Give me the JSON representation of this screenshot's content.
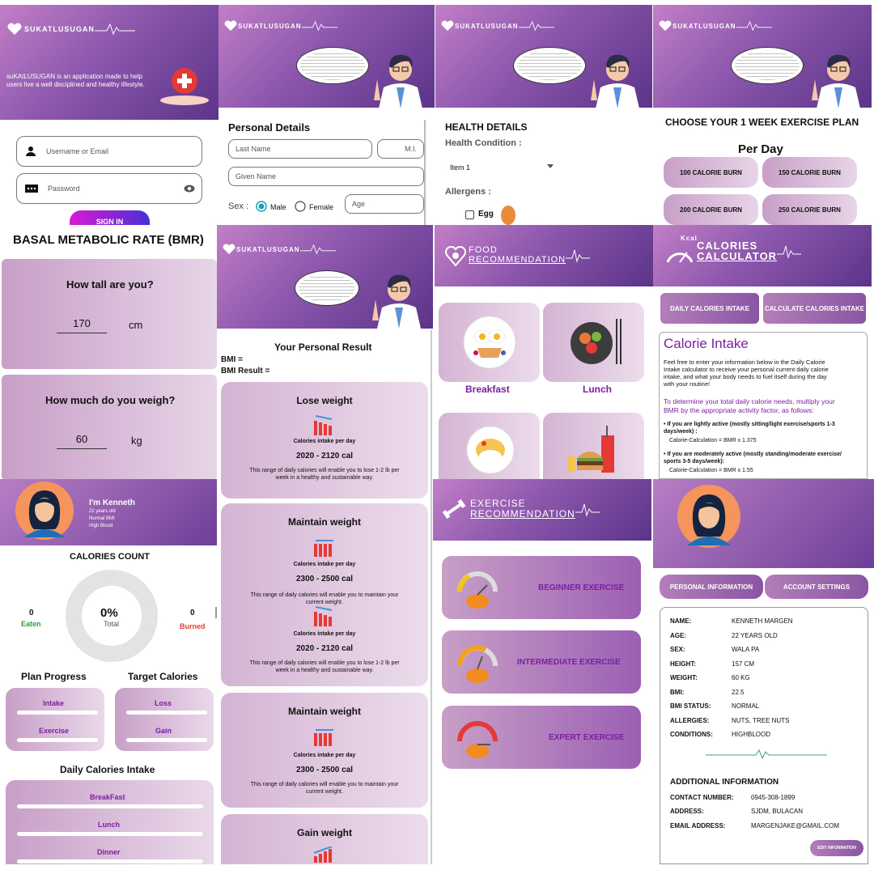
{
  "login": {
    "logo": "SUKATLUSUGAN",
    "tagline": "suKAtLUSUGAN is an application made to help users live a well disciplined and healthy lifestyle.",
    "username_placeholder": "Username or Email",
    "password_placeholder": "Password",
    "signin": "SIGN IN"
  },
  "personal": {
    "logo": "SUKATLUSUGAN",
    "title": "Personal Details",
    "last_name": "Last Name",
    "mi": "M.I.",
    "given_name": "Given Name",
    "sex_label": "Sex :",
    "male": "Male",
    "female": "Female",
    "age": "Age"
  },
  "health": {
    "logo": "SUKATLUSUGAN",
    "title": "HEALTH DETAILS",
    "condition_label": "Health Condition :",
    "condition_value": "Item 1",
    "allergens_label": "Allergens :",
    "egg": "Egg"
  },
  "exercise_plan": {
    "logo": "SUKATLUSUGAN",
    "title": "CHOOSE YOUR 1 WEEK EXERCISE PLAN",
    "subtitle": "Per Day",
    "options": [
      "100 CALORIE BURN",
      "150 CALORIE BURN",
      "200 CALORIE BURN",
      "250 CALORIE BURN"
    ]
  },
  "bmr": {
    "title": "BASAL METABOLIC RATE (BMR)",
    "q_height": "How tall are you?",
    "height": "170",
    "height_unit": "cm",
    "q_weight": "How much do you weigh?",
    "weight": "60",
    "weight_unit": "kg"
  },
  "result": {
    "logo": "SUKATLUSUGAN",
    "title": "Your Personal Result",
    "bmi": "BMI =",
    "bmi_result": "BMI Result =",
    "per_day": "Calories intake per day",
    "cards": [
      {
        "title": "Lose weight",
        "range": "2020 - 2120 cal",
        "desc1": "This range of daily calories will enable you to lose 1-2 lb per",
        "desc2": "week in a healthy and sustainable way."
      },
      {
        "title": "Maintain weight",
        "range": "2300 - 2500 cal",
        "desc1": "This range of daily calories will enable you to maintain your",
        "desc2": "current weight."
      },
      {
        "range": "2020 - 2120 cal",
        "desc1": "This range of daily calories will enable you to lose 1-2 lb per",
        "desc2": "week in a healthy and sustainable way."
      },
      {
        "title": "Maintain weight",
        "range": "2300 - 2500 cal",
        "desc1": "This range of daily calories will enable you to maintain your",
        "desc2": "current weight."
      },
      {
        "title": "Gain weight"
      }
    ]
  },
  "food": {
    "logo1": "FOOD",
    "logo2": "RECOMMENDATION",
    "breakfast": "Breakfast",
    "lunch": "Lunch"
  },
  "calc": {
    "logo1": "CALORIES",
    "logo2": "CALCULATOR",
    "kcal": "Kcal",
    "tab1": "DAILY CALORIES INTAKE",
    "tab2": "CALCULATE CALORIES INTAKE",
    "heading": "Calorie Intake",
    "p1": [
      "Feel free to enter your information below in the Daily Calorie",
      "Intake calculator to receive your personal current daily calorie",
      "intake, and what your body needs to fuel itself during the day",
      "with your routine!"
    ],
    "p2": [
      "To determine your total daily calorie needs, multiply your",
      "BMR by the appropriate activity factor, as follows:"
    ],
    "b1": [
      "• If you are lightly active (mostly sitting/light exercise/sports 1-3",
      "days/week) :"
    ],
    "c1": "Calorie-Calculation = BMR x 1.375",
    "b2": [
      "• If you are moderately active (mostly standing/moderate exercise/",
      "sports 3-5 days/week):"
    ],
    "c2": "Calorie-Calculation = BMR x 1.55"
  },
  "dash": {
    "name": "I'm Kenneth",
    "age": "22 years old",
    "bmi": "Normal BMI",
    "cond": "High Blood",
    "count_title": "CALORIES COUNT",
    "eaten_val": "0",
    "eaten": "Eaten",
    "total_val": "0%",
    "total": "Total",
    "burned_val": "0",
    "burned": "Burned",
    "plan": "Plan Progress",
    "target": "Target Calories",
    "intake": "Intake",
    "exercise": "Exercise",
    "loss": "Loss",
    "gain": "Gain",
    "daily": "Daily Calories Intake",
    "meals": [
      "BreakFast",
      "Lunch",
      "Dinner"
    ]
  },
  "exrec": {
    "logo1": "EXERCISE",
    "logo2": "RECOMMENDATION",
    "levels": [
      "BEGINNER EXERCISE",
      "INTERMEDIATE EXERCISE",
      "EXPERT EXERCISE"
    ]
  },
  "profile": {
    "tab1": "PERSONAL INFORMATION",
    "tab2": "ACCOUNT SETTINGS",
    "fields": [
      [
        "NAME:",
        "KENNETH MARGEN"
      ],
      [
        "AGE:",
        "22 YEARS OLD"
      ],
      [
        "SEX:",
        "WALA PA"
      ],
      [
        "HEIGHT:",
        "157 CM"
      ],
      [
        "WEIGHT:",
        "60 KG"
      ],
      [
        "BMI:",
        "22.5"
      ],
      [
        "BMI STATUS:",
        "NORMAL"
      ],
      [
        "ALLERGIES:",
        "NUTS, TREE NUTS"
      ],
      [
        "CONDITIONS:",
        "HIGHBLOOD"
      ]
    ],
    "add_title": "ADDITIONAL INFORMATION",
    "add": [
      [
        "CONTACT NUMBER:",
        "0945-308-1899"
      ],
      [
        "ADDRESS:",
        "SJDM, BULACAN"
      ],
      [
        "EMAIL ADDRESS:",
        "MARGENJAKE@GMAIL.COM"
      ]
    ],
    "edit": "EDIT INFORMATION"
  },
  "colors": {
    "accent": "#8c57ad",
    "purple_text": "#7b1fa2",
    "red": "#e53935",
    "green": "#2e9d3a"
  }
}
